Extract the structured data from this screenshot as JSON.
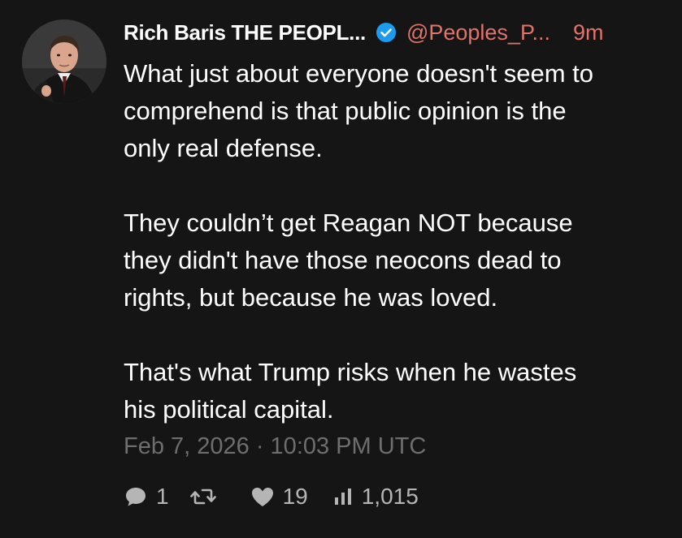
{
  "author": {
    "name": "Rich Baris THE PEOPL...",
    "handle": "@Peoples_P...",
    "time_ago": "9m",
    "verified": true,
    "accent_color": "#e0736a",
    "verified_color": "#1d9bf0"
  },
  "tweet": {
    "paragraphs": [
      "What just about everyone doesn't seem to\ncomprehend is that public opinion is the\nonly real defense.",
      "They couldn’t get Reagan NOT because\nthey didn't have those neocons dead to\nrights, but because he was loved.",
      "That's what Trump risks when he wastes\nhis political capital."
    ],
    "timestamp": "Feb 7, 2026 · 10:03 PM UTC"
  },
  "stats": {
    "replies": "1",
    "retweets": "",
    "likes": "19",
    "views": "1,015",
    "icons": [
      "comment-icon",
      "retweet-icon",
      "heart-icon",
      "bar-chart-icon"
    ]
  }
}
